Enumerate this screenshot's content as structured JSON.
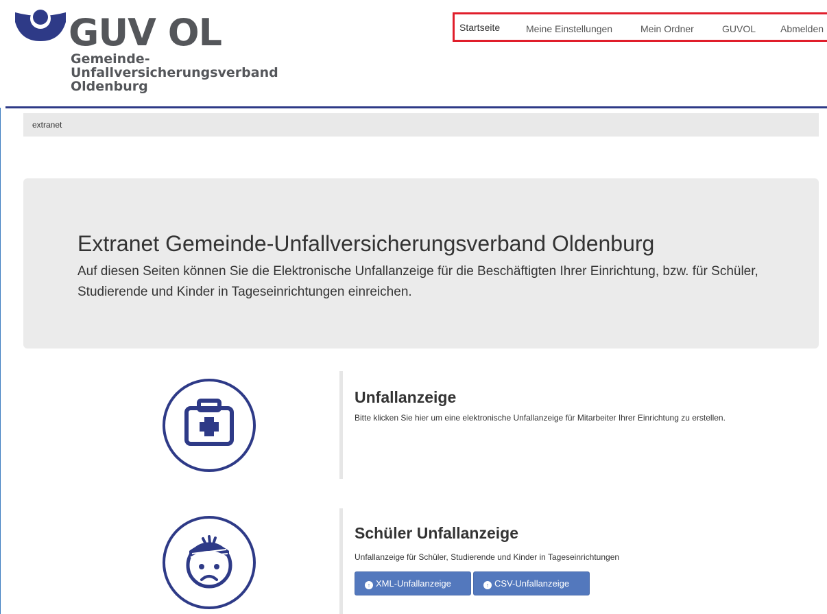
{
  "logo": {
    "name": "GUV OL",
    "subtitle_lines": [
      "Gemeinde-",
      "Unfallversicherungsverband",
      "Oldenburg"
    ]
  },
  "topnav": {
    "items": [
      "Startseite",
      "Meine Einstellungen",
      "Mein Ordner",
      "GUVOL",
      "Abmelden"
    ]
  },
  "breadcrumb": {
    "current": "extranet"
  },
  "jumbotron": {
    "title": "Extranet Gemeinde-Unfallversicherungsverband Oldenburg",
    "text": "Auf diesen Seiten können Sie die Elektronische Unfallanzeige für die Beschäftigten Ihrer Einrichtung, bzw. für Schüler, Studierende und Kinder in Tageseinrichtungen einreichen."
  },
  "cards": [
    {
      "icon": "first-aid-kit-icon",
      "title": "Unfallanzeige",
      "text": "Bitte klicken Sie hier um eine elektronische Unfallanzeige für Mitarbeiter Ihrer Einrichtung zu erstellen."
    },
    {
      "icon": "injured-child-icon",
      "title": "Schüler Unfallanzeige",
      "text": "Unfallanzeige für Schüler, Studierende und Kinder in Tageseinrichtungen",
      "buttons": [
        "XML-Unfallanzeige",
        "CSV-Unfallanzeige"
      ]
    }
  ],
  "colors": {
    "brand_blue": "#2e3a87",
    "icon_blue": "#2e3a87",
    "button_blue": "#5378bd",
    "highlight_red": "#e01e2b",
    "panel_gray": "#ebebeb"
  }
}
